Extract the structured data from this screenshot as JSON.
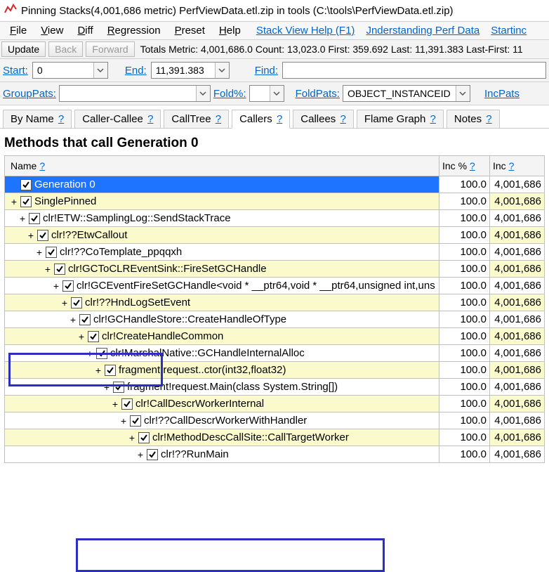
{
  "titlebar": {
    "title": "Pinning Stacks(4,001,686 metric) PerfViewData.etl.zip in tools (C:\\tools\\PerfViewData.etl.zip)"
  },
  "menu": {
    "file": "File",
    "view": "View",
    "diff": "Diff",
    "regression": "Regression",
    "preset": "Preset",
    "help": "Help",
    "stack_view_help": "Stack View Help (F1)",
    "understanding_perf_data": "Jnderstanding Perf Data",
    "starting": "Startinc"
  },
  "toolbar": {
    "update": "Update",
    "back": "Back",
    "forward": "Forward",
    "stats": "Totals Metric: 4,001,686.0  Count: 13,023.0  First: 359.692 Last: 11,391.383  Last-First: 11"
  },
  "range": {
    "start_label": "Start:",
    "start_value": "0",
    "end_label": "End:",
    "end_value": "11,391.383",
    "find_label": "Find:",
    "find_value": ""
  },
  "group": {
    "grouppats_label": "GroupPats:",
    "grouppats_value": "",
    "foldpct_label": "Fold%:",
    "foldpct_value": "",
    "foldpats_label": "FoldPats:",
    "foldpats_value": "OBJECT_INSTANCEID;",
    "incpats_label": "IncPats"
  },
  "tabs": {
    "by_name": "By Name",
    "caller_callee": "Caller-Callee",
    "calltree": "CallTree",
    "callers": "Callers",
    "callees": "Callees",
    "flame_graph": "Flame Graph",
    "notes": "Notes",
    "q": "?"
  },
  "heading": "Methods that call Generation 0",
  "grid": {
    "name_header": "Name",
    "incpct_header": "Inc %",
    "inc_header": "Inc",
    "q": "?"
  },
  "rows": [
    {
      "indent": 0,
      "exp": "",
      "chk": true,
      "name": "Generation 0",
      "incpct": "100.0",
      "inc": "4,001,686",
      "sel": true,
      "alt": false,
      "hl": "A"
    },
    {
      "indent": 0,
      "exp": "+",
      "chk": true,
      "name": "SinglePinned",
      "incpct": "100.0",
      "inc": "4,001,686",
      "alt": true,
      "hl": "A"
    },
    {
      "indent": 1,
      "exp": "+",
      "chk": true,
      "name": "clr!ETW::SamplingLog::SendStackTrace",
      "incpct": "100.0",
      "inc": "4,001,686",
      "alt": false
    },
    {
      "indent": 2,
      "exp": "+",
      "chk": true,
      "name": "clr!??EtwCallout",
      "incpct": "100.0",
      "inc": "4,001,686",
      "alt": true
    },
    {
      "indent": 3,
      "exp": "+",
      "chk": true,
      "name": "clr!??CoTemplate_ppqqxh",
      "incpct": "100.0",
      "inc": "4,001,686",
      "alt": false
    },
    {
      "indent": 4,
      "exp": "+",
      "chk": true,
      "name": "clr!GCToCLREventSink::FireSetGCHandle",
      "incpct": "100.0",
      "inc": "4,001,686",
      "alt": true
    },
    {
      "indent": 5,
      "exp": "+",
      "chk": true,
      "name": "clr!GCEventFireSetGCHandle<void * __ptr64,void * __ptr64,unsigned int,uns",
      "incpct": "100.0",
      "inc": "4,001,686",
      "alt": false
    },
    {
      "indent": 6,
      "exp": "+",
      "chk": true,
      "name": "clr!??HndLogSetEvent",
      "incpct": "100.0",
      "inc": "4,001,686",
      "alt": true
    },
    {
      "indent": 7,
      "exp": "+",
      "chk": true,
      "name": "clr!GCHandleStore::CreateHandleOfType",
      "incpct": "100.0",
      "inc": "4,001,686",
      "alt": false
    },
    {
      "indent": 8,
      "exp": "+",
      "chk": true,
      "name": "clr!CreateHandleCommon",
      "incpct": "100.0",
      "inc": "4,001,686",
      "alt": true
    },
    {
      "indent": 9,
      "exp": "+",
      "chk": true,
      "name": "clr!MarshalNative::GCHandleInternalAlloc",
      "incpct": "100.0",
      "inc": "4,001,686",
      "alt": false
    },
    {
      "indent": 10,
      "exp": "+",
      "chk": true,
      "name": "fragment!request..ctor(int32,float32)",
      "incpct": "100.0",
      "inc": "4,001,686",
      "alt": true,
      "hl": "B"
    },
    {
      "indent": 11,
      "exp": "+",
      "chk": true,
      "name": "fragment!request.Main(class System.String[])",
      "incpct": "100.0",
      "inc": "4,001,686",
      "alt": false,
      "hl": "B"
    },
    {
      "indent": 12,
      "exp": "+",
      "chk": true,
      "name": "clr!CallDescrWorkerInternal",
      "incpct": "100.0",
      "inc": "4,001,686",
      "alt": true
    },
    {
      "indent": 13,
      "exp": "+",
      "chk": true,
      "name": "clr!??CallDescrWorkerWithHandler",
      "incpct": "100.0",
      "inc": "4,001,686",
      "alt": false
    },
    {
      "indent": 14,
      "exp": "+",
      "chk": true,
      "name": "clr!MethodDescCallSite::CallTargetWorker",
      "incpct": "100.0",
      "inc": "4,001,686",
      "alt": true
    },
    {
      "indent": 15,
      "exp": "+",
      "chk": true,
      "name": "clr!??RunMain",
      "incpct": "100.0",
      "inc": "4,001,686",
      "alt": false
    }
  ]
}
